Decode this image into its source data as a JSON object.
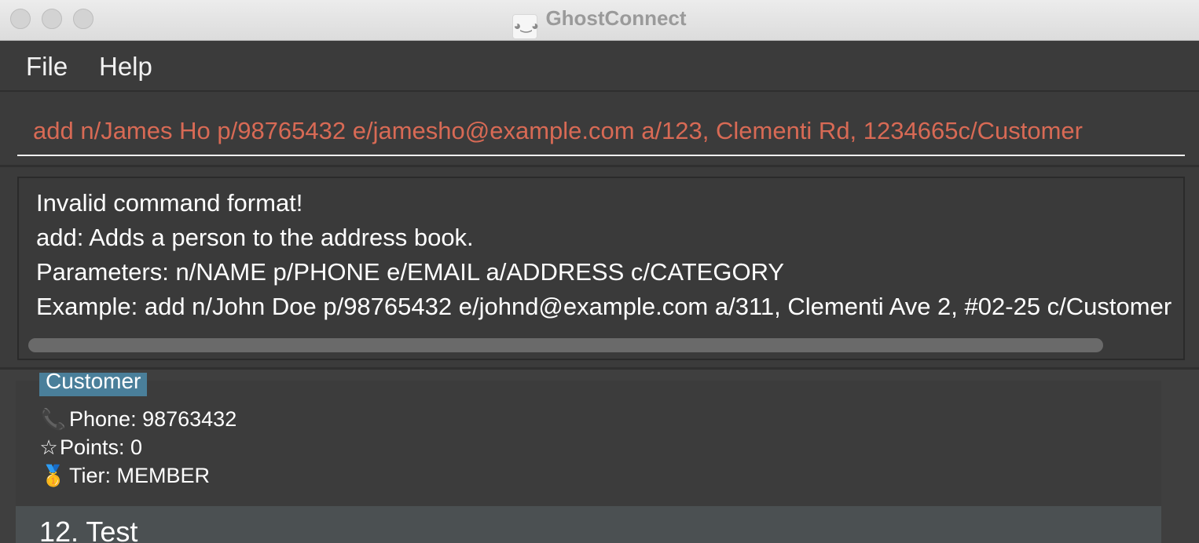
{
  "window": {
    "title": "GhostConnect",
    "app_icon": "ghost-icon"
  },
  "menu": {
    "file": "File",
    "help": "Help"
  },
  "command": {
    "value": "add n/James Ho p/98765432 e/jamesho@example.com a/123, Clementi Rd, 1234665c/Customer",
    "color": "#d86a55"
  },
  "result": {
    "lines": [
      "Invalid command format!",
      "add: Adds a person to the address book.",
      "Parameters: n/NAME p/PHONE e/EMAIL a/ADDRESS c/CATEGORY",
      "Example: add n/John Doe p/98765432 e/johnd@example.com a/311, Clementi Ave 2, #02-25 c/Customer"
    ]
  },
  "persons": [
    {
      "tag": "Customer",
      "phone": "Phone: 98763432",
      "points": "Points: 0",
      "tier": "Tier: MEMBER"
    },
    {
      "name": "12. Test"
    }
  ],
  "colors": {
    "accent_tag": "#4a7f9a",
    "background": "#3f3f3f"
  }
}
